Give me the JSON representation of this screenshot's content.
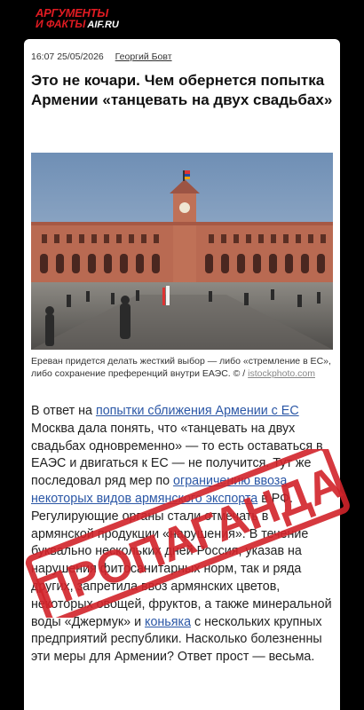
{
  "logo": {
    "line1": "АРГУМЕНТЫ",
    "line2": "И ФАКТЫ",
    "domain": "AIF.RU"
  },
  "article": {
    "time": "16:07 25/05/2026",
    "author": "Георгий Бовт",
    "title": "Это не кочари. Чем обернется попытка Армении «танцевать на двух свадьбах»",
    "caption": "Ереван придется делать жесткий выбор — либо «стремление в ЕС», либо сохранение преференций внутри ЕАЭС. © / ",
    "caption_source": "istockphoto.com",
    "body": {
      "p1": "В ответ на ",
      "link1": "попытки сближения Армении с ЕС",
      "p2": " Москва дала понять, что «танцевать на двух свадьбах одновременно» — то есть оставаться в ЕАЭС и двигаться к ЕС — не получится. Тут же последовал ряд мер по ",
      "link2": "ограничению ввоза некоторых видов армянского экспорта",
      "p3": " в РФ. Регулирующие органы стали отмечать в армянской продукции «нарушения». В течение буквально нескольких дней Россия, указав на нарушения фитосанитарных норм, так и ряда других, запретила ввоз армянских цветов, некоторых овощей, фруктов, а также минеральной воды «Джермук» и ",
      "link3": "коньяка",
      "p4": " с нескольких крупных предприятий республики. Насколько болезненны эти меры для Армении? Ответ прост — весьма."
    }
  },
  "stamp": {
    "text": "ПРОПАГАНДА",
    "color": "#d2232a"
  }
}
